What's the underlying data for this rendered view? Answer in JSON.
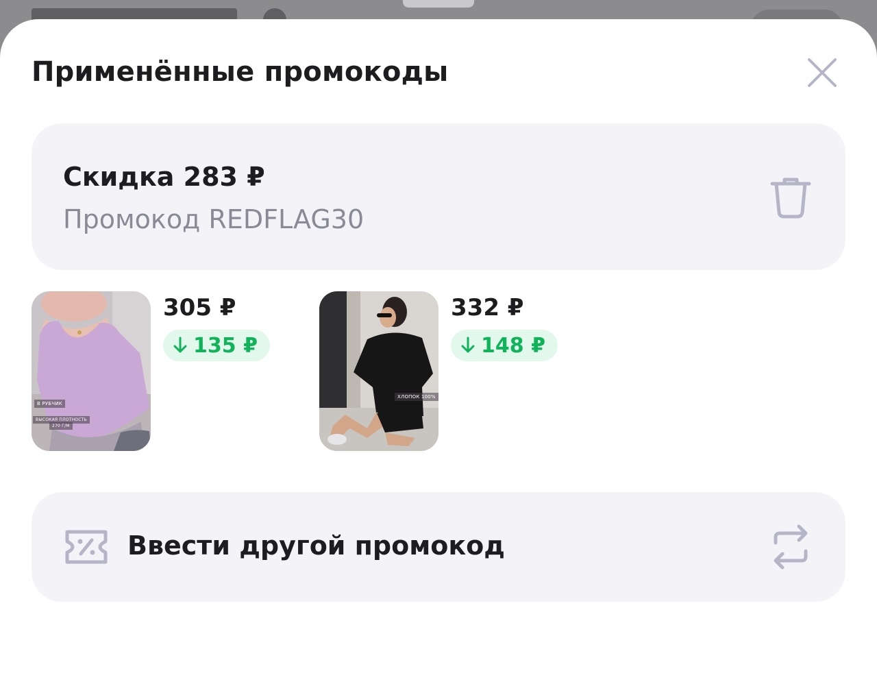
{
  "sheet": {
    "title": "Применённые промокоды"
  },
  "promo": {
    "discount": "Скидка 283 ₽",
    "code_line": "Промокод REDFLAG30"
  },
  "items": [
    {
      "price": "305 ₽",
      "saving": "135 ₽",
      "thumb_labels": [
        "В РУБЧИК",
        "ВЫСОКАЯ ПЛОТНОСТЬ",
        "270 Г/М"
      ]
    },
    {
      "price": "332 ₽",
      "saving": "148 ₽",
      "thumb_labels": [
        "ХЛОПОК 100%"
      ]
    }
  ],
  "enter_other": {
    "label": "Ввести другой промокод"
  },
  "colors": {
    "accent_green": "#10b35a",
    "green_bg": "#e3f8ec",
    "card_bg": "#f4f4f8",
    "icon_gray": "#b6b5c8"
  },
  "icons": {
    "close": "close-icon",
    "trash": "trash-icon",
    "arrow_down": "arrow-down-icon",
    "coupon": "coupon-percent-icon",
    "swap": "swap-arrows-icon"
  }
}
